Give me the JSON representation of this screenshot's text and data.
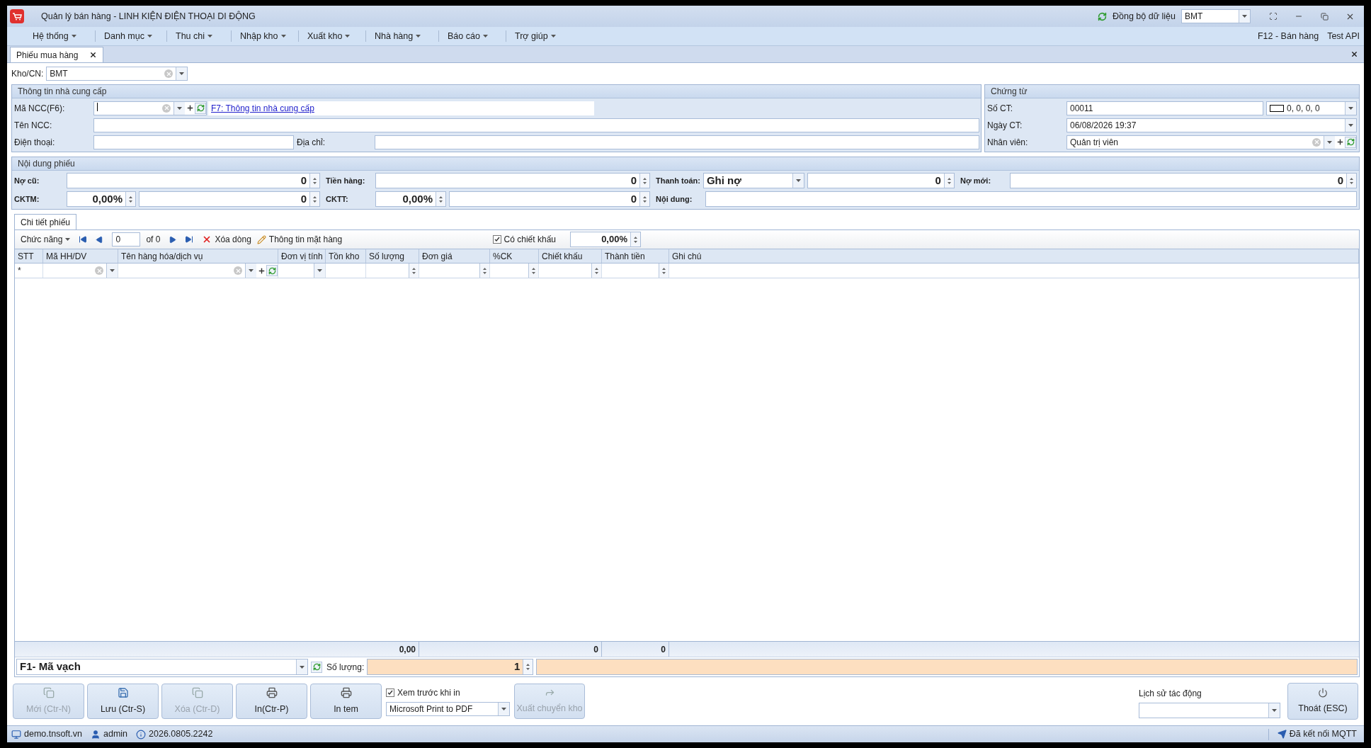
{
  "window": {
    "title": "Quản lý bán hàng - LINH KIỆN ĐIỆN THOẠI DI ĐỘNG",
    "sync_label": "Đồng bộ dữ liệu",
    "branch": "BMT"
  },
  "menu": [
    {
      "label": "Hệ thống"
    },
    {
      "label": "Danh mục"
    },
    {
      "label": "Thu chi"
    },
    {
      "label": "Nhập kho"
    },
    {
      "label": "Xuất kho"
    },
    {
      "label": "Nhà hàng"
    },
    {
      "label": "Báo cáo"
    },
    {
      "label": "Trợ giúp"
    }
  ],
  "menu_right": [
    "F12 - Bán hàng",
    "Test API"
  ],
  "tabs": [
    {
      "label": "Phiếu mua hàng",
      "selected": true
    }
  ],
  "kho": {
    "label": "Kho/CN:",
    "value": "BMT"
  },
  "supplier": {
    "title": "Thông tin nhà cung cấp",
    "code_label": "Mã NCC(F6):",
    "link": "F7: Thông tin nhà cung cấp",
    "name_label": "Tên NCC:",
    "phone_label": "Điện thoại:",
    "address_label": "Địa chỉ:"
  },
  "voucher": {
    "title": "Chứng từ",
    "number_label": "Số CT:",
    "number": "00011",
    "color_value": "0, 0, 0, 0",
    "date_label": "Ngày CT:",
    "date": "06/08/2026 19:37",
    "staff_label": "Nhân viên:",
    "staff": "Quản trị viên"
  },
  "content": {
    "title": "Nội dung phiếu",
    "old_debt_label": "Nợ cũ:",
    "old_debt": "0",
    "goods_label": "Tiền hàng:",
    "goods": "0",
    "payment_label": "Thanh toán:",
    "payment_method": "Ghi nợ",
    "payment": "0",
    "new_debt_label": "Nợ mới:",
    "new_debt": "0",
    "cktm_label": "CKTM:",
    "cktm_pct": "0,00%",
    "cktm": "0",
    "cktt_label": "CKTT:",
    "cktt_pct": "0,00%",
    "cktt": "0",
    "note_label": "Nội dung:"
  },
  "detail": {
    "tabs": [
      {
        "label": "Chi tiết phiếu",
        "selected": true
      }
    ],
    "toolbar": {
      "functions": "Chức năng",
      "page": "0",
      "of": "of 0",
      "delete": "Xóa dòng",
      "item_info": "Thông tin mặt hàng",
      "discount": {
        "label": "Có chiết khấu",
        "checked": true
      },
      "discount_value": "0,00%"
    },
    "columns": [
      {
        "label": "STT",
        "kind": "marker"
      },
      {
        "label": "Mã HH/DV",
        "kind": "combo"
      },
      {
        "label": "Tên hàng hóa/dịch vụ",
        "kind": "lookup"
      },
      {
        "label": "Đơn vị tính",
        "kind": "dropdown"
      },
      {
        "label": "Tồn kho",
        "kind": "text"
      },
      {
        "label": "Số lượng",
        "kind": "spin",
        "total": "0,00"
      },
      {
        "label": "Đơn giá",
        "kind": "spin"
      },
      {
        "label": "%CK",
        "kind": "spin"
      },
      {
        "label": "Chiết khấu",
        "kind": "spin",
        "total": "0"
      },
      {
        "label": "Thành tiền",
        "kind": "spin",
        "total": "0"
      },
      {
        "label": "Ghi chú",
        "kind": "text"
      }
    ],
    "new_row_marker": "*"
  },
  "barcode": {
    "mode": "F1- Mã vạch",
    "qty_label": "Số lượng:",
    "qty": "1"
  },
  "actions": [
    {
      "label": "Mới (Ctr-N)",
      "kind": "new",
      "disabled": true
    },
    {
      "label": "Lưu (Ctr-S)",
      "kind": "save",
      "disabled": false
    },
    {
      "label": "Xóa (Ctr-D)",
      "kind": "new",
      "disabled": true
    },
    {
      "label": "In(Ctr-P)",
      "kind": "print",
      "disabled": false
    },
    {
      "label": "In tem",
      "kind": "print",
      "disabled": false
    }
  ],
  "preview": {
    "label": "Xem trước khi in",
    "checked": true
  },
  "printer": "Microsoft Print to PDF",
  "transfer": {
    "label": "Xuất chuyển kho",
    "disabled": true
  },
  "history_label": "Lịch sử tác động",
  "exit": "Thoát (ESC)",
  "status_bar": {
    "site": "demo.tnsoft.vn",
    "user": "admin",
    "version": "2026.0805.2242",
    "mqtt": "Đã kết nối MQTT"
  }
}
